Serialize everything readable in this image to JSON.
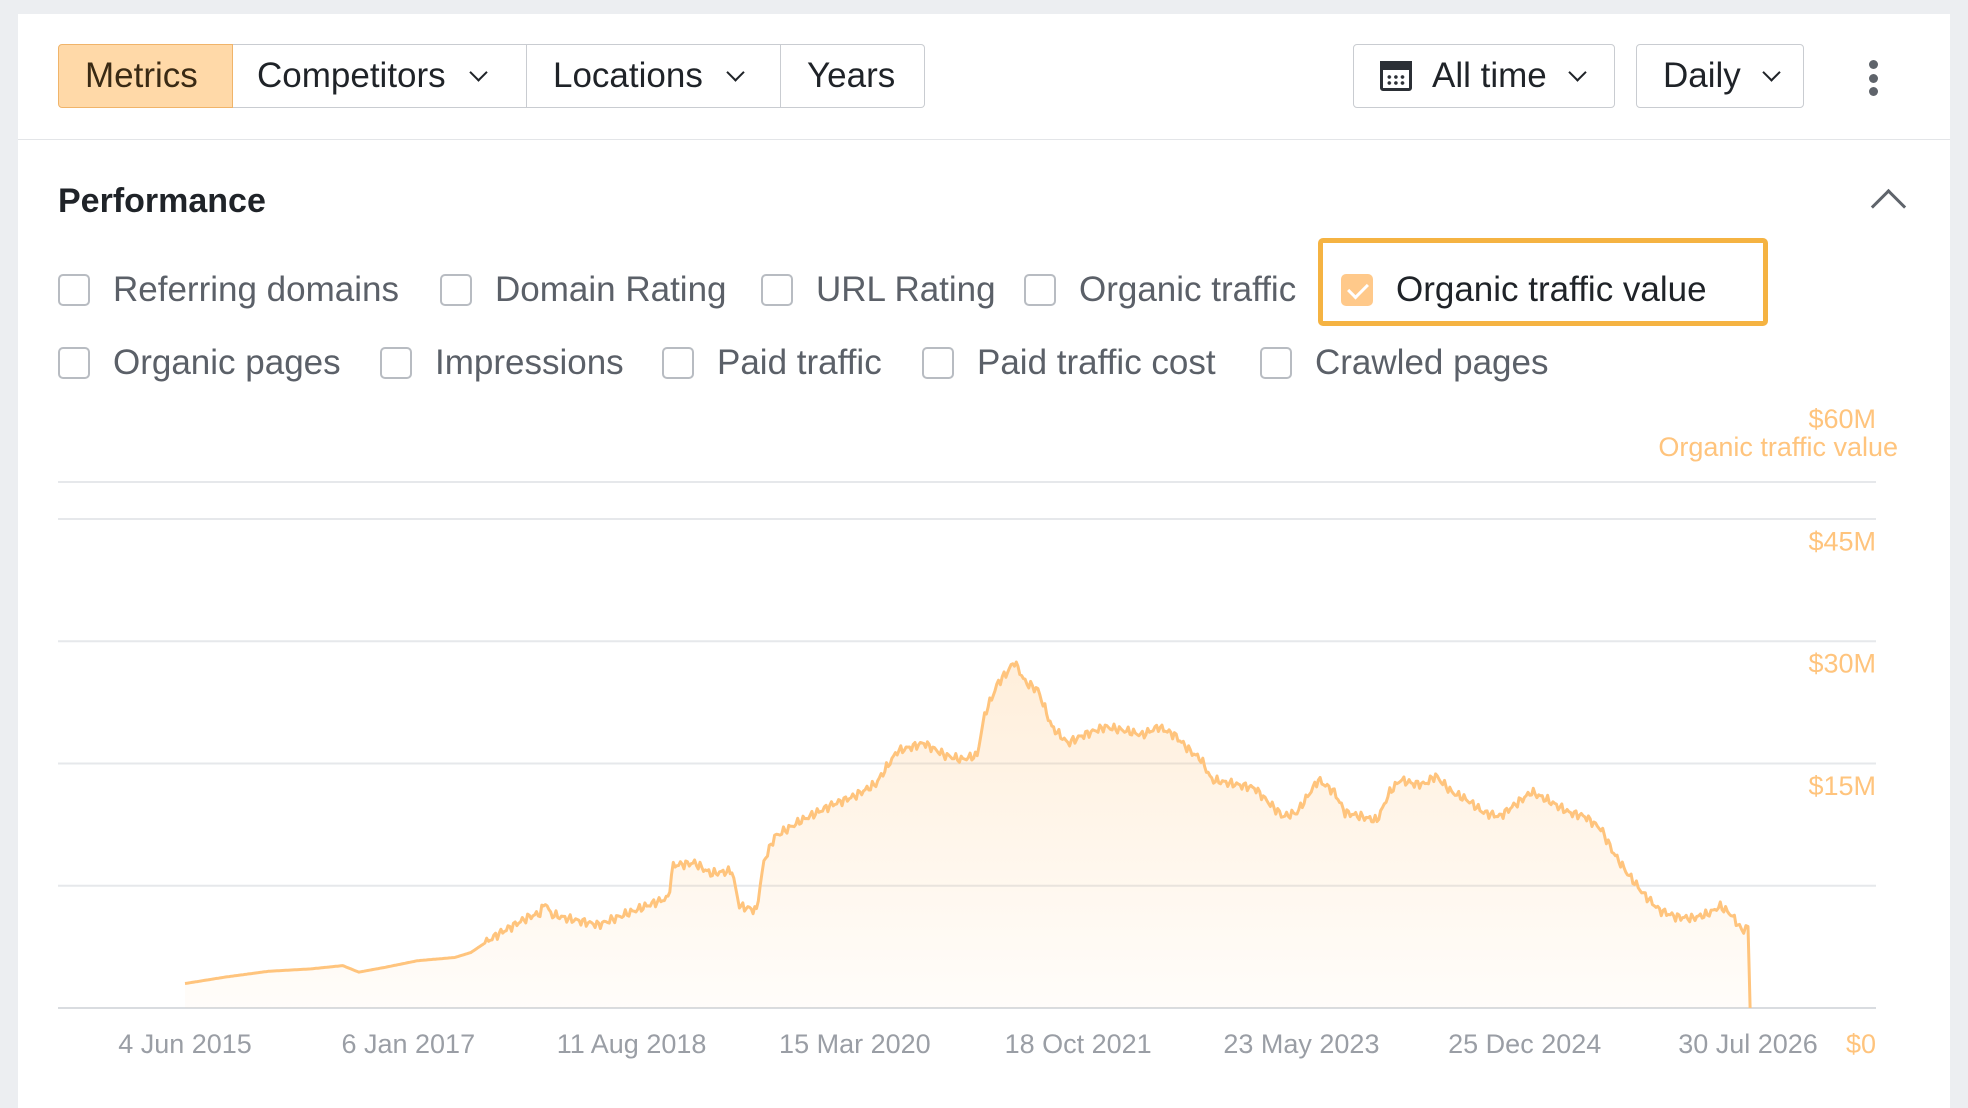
{
  "toolbar": {
    "tabs": [
      {
        "label": "Metrics",
        "active": true
      },
      {
        "label": "Competitors",
        "dropdown": true
      },
      {
        "label": "Locations",
        "dropdown": true
      },
      {
        "label": "Years"
      }
    ],
    "date_range": "All time",
    "granularity": "Daily"
  },
  "section": {
    "title": "Performance",
    "metrics": [
      {
        "label": "Referring domains",
        "checked": false
      },
      {
        "label": "Domain Rating",
        "checked": false
      },
      {
        "label": "URL Rating",
        "checked": false
      },
      {
        "label": "Organic traffic",
        "checked": false
      },
      {
        "label": "Organic traffic value",
        "checked": true
      },
      {
        "label": "Organic pages",
        "checked": false
      },
      {
        "label": "Impressions",
        "checked": false
      },
      {
        "label": "Paid traffic",
        "checked": false
      },
      {
        "label": "Paid traffic cost",
        "checked": false
      },
      {
        "label": "Crawled pages",
        "checked": false
      }
    ]
  },
  "colors": {
    "accent": "#ffc47d",
    "active_tab": "#ffd9a8",
    "highlight_border": "#f5b342"
  },
  "chart_data": {
    "type": "area",
    "series": [
      {
        "name": "Organic traffic value",
        "color": "#ffc47d"
      }
    ],
    "x_ticks": [
      "4 Jun 2015",
      "6 Jan 2017",
      "11 Aug 2018",
      "15 Mar 2020",
      "18 Oct 2021",
      "23 May 2023",
      "25 Dec 2024",
      "30 Jul 2026"
    ],
    "y_ticks": [
      "$0",
      "$15M",
      "$30M",
      "$45M",
      "$60M"
    ],
    "ylim": [
      0,
      60
    ],
    "grid": true,
    "points": [
      [
        2015.42,
        3.0
      ],
      [
        2015.8,
        3.8
      ],
      [
        2016.2,
        4.5
      ],
      [
        2016.6,
        4.8
      ],
      [
        2016.9,
        5.2
      ],
      [
        2017.05,
        4.4
      ],
      [
        2017.3,
        5.0
      ],
      [
        2017.6,
        5.8
      ],
      [
        2017.95,
        6.2
      ],
      [
        2018.1,
        6.8
      ],
      [
        2018.35,
        9.0
      ],
      [
        2018.55,
        10.5
      ],
      [
        2018.65,
        11.2
      ],
      [
        2018.75,
        11.6
      ],
      [
        2018.8,
        13.0
      ],
      [
        2018.85,
        11.5
      ],
      [
        2019.0,
        11.0
      ],
      [
        2019.3,
        10.2
      ],
      [
        2019.55,
        11.5
      ],
      [
        2019.8,
        12.8
      ],
      [
        2019.95,
        13.5
      ],
      [
        2020.0,
        17.5
      ],
      [
        2020.2,
        17.8
      ],
      [
        2020.35,
        16.5
      ],
      [
        2020.55,
        16.8
      ],
      [
        2020.62,
        12.5
      ],
      [
        2020.78,
        12.0
      ],
      [
        2020.85,
        18.0
      ],
      [
        2020.95,
        21.0
      ],
      [
        2021.2,
        23.0
      ],
      [
        2021.5,
        25.0
      ],
      [
        2021.7,
        26.0
      ],
      [
        2021.9,
        27.5
      ],
      [
        2022.1,
        31.5
      ],
      [
        2022.35,
        32.5
      ],
      [
        2022.55,
        31.0
      ],
      [
        2022.7,
        30.5
      ],
      [
        2022.85,
        31.0
      ],
      [
        2022.92,
        36.0
      ],
      [
        2023.05,
        40.0
      ],
      [
        2023.12,
        41.0
      ],
      [
        2023.2,
        42.5
      ],
      [
        2023.3,
        40.0
      ],
      [
        2023.42,
        39.0
      ],
      [
        2023.55,
        34.5
      ],
      [
        2023.7,
        32.5
      ],
      [
        2023.85,
        33.5
      ],
      [
        2024.05,
        34.5
      ],
      [
        2024.25,
        34.0
      ],
      [
        2024.4,
        33.5
      ],
      [
        2024.55,
        34.5
      ],
      [
        2024.7,
        33.5
      ],
      [
        2024.85,
        31.5
      ],
      [
        2024.95,
        30.5
      ],
      [
        2025.05,
        28.0
      ],
      [
        2025.25,
        27.5
      ],
      [
        2025.45,
        27.0
      ],
      [
        2025.6,
        25.0
      ],
      [
        2025.72,
        23.5
      ],
      [
        2025.85,
        24.0
      ],
      [
        2026.05,
        28.0
      ],
      [
        2026.2,
        26.5
      ],
      [
        2026.3,
        24.0
      ],
      [
        2026.45,
        23.5
      ],
      [
        2026.6,
        23.0
      ],
      [
        2026.72,
        26.5
      ],
      [
        2026.82,
        28.0
      ],
      [
        2026.95,
        27.5
      ],
      [
        2027.05,
        27.5
      ],
      [
        2027.15,
        28.5
      ],
      [
        2027.3,
        26.5
      ],
      [
        2027.45,
        25.5
      ],
      [
        2027.6,
        24.0
      ],
      [
        2027.75,
        23.5
      ],
      [
        2027.9,
        25.0
      ],
      [
        2028.05,
        26.5
      ],
      [
        2028.2,
        25.5
      ],
      [
        2028.4,
        24.0
      ],
      [
        2028.55,
        23.5
      ],
      [
        2028.7,
        22.0
      ],
      [
        2028.82,
        19.0
      ],
      [
        2028.95,
        16.5
      ],
      [
        2029.1,
        14.0
      ],
      [
        2029.25,
        12.0
      ],
      [
        2029.4,
        11.2
      ],
      [
        2029.55,
        11.0
      ],
      [
        2029.7,
        11.5
      ],
      [
        2029.82,
        12.5
      ],
      [
        2029.92,
        11.5
      ],
      [
        2030.0,
        10.0
      ],
      [
        2030.04,
        9.5
      ],
      [
        2030.08,
        10.0
      ],
      [
        2030.1,
        0.0
      ]
    ]
  }
}
